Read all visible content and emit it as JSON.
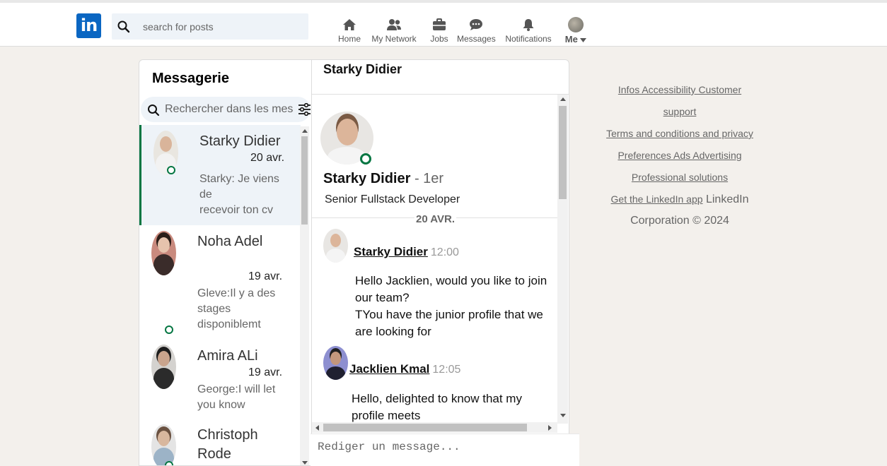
{
  "nav": {
    "search_placeholder": "search for posts",
    "items": [
      {
        "label": "Home",
        "icon": "home-icon"
      },
      {
        "label": "My Network",
        "icon": "network-icon"
      },
      {
        "label": "Jobs",
        "icon": "briefcase-icon"
      },
      {
        "label": "Messages",
        "icon": "chat-icon"
      },
      {
        "label": "Notifications",
        "icon": "bell-icon"
      }
    ],
    "me_label": "Me",
    "brand_color": "#0a66c2"
  },
  "messaging": {
    "title": "Messagerie",
    "search_placeholder": "Rechercher dans les messages",
    "conversations": [
      {
        "name": "Starky Didier",
        "date": "20 avr.",
        "snippet_lines": [
          "Starky: Je viens",
          "de",
          "recevoir ton cv"
        ],
        "active": true
      },
      {
        "name": "Noha Adel",
        "date": "19 avr.",
        "snippet_lines": [
          "Gleve:Il y a des",
          "stages",
          "disponiblemt"
        ],
        "active": false
      },
      {
        "name": "Amira ALi",
        "date": "19 avr.",
        "snippet_lines": [
          "George:I will let",
          "you know"
        ],
        "active": false
      },
      {
        "name_lines": [
          "Christoph",
          "Rode"
        ],
        "active": false
      }
    ],
    "online_color": "#057642"
  },
  "chat": {
    "header_name": "Starky Didier",
    "profile": {
      "name": "Starky Didier",
      "degree": " - 1er",
      "title": "Senior Fullstack Developer"
    },
    "day_separator": "20 AVR.",
    "messages": [
      {
        "sender": "Starky Didier",
        "time": "12:00",
        "lines": [
          "Hello Jacklien, would you like to join",
          "our team?",
          "TYou have the junior profile that we",
          "are looking for"
        ]
      },
      {
        "sender": "Jacklien Kmal",
        "time": "12:05",
        "lines": [
          "Hello, delighted to know that my",
          "profile meets"
        ]
      }
    ],
    "composer_placeholder": "Rediger un message..."
  },
  "footer": {
    "line1": "Infos  Accessibility   Customer",
    "line2": "support",
    "line3": "Terms and conditions and privacy",
    "line4": "Preferences Ads Advertising ",
    "line5": "Professional solutions",
    "line6_link": "Get the LinkedIn app",
    "line6_text": " LinkedIn",
    "line7": "Corporation © 2024"
  }
}
